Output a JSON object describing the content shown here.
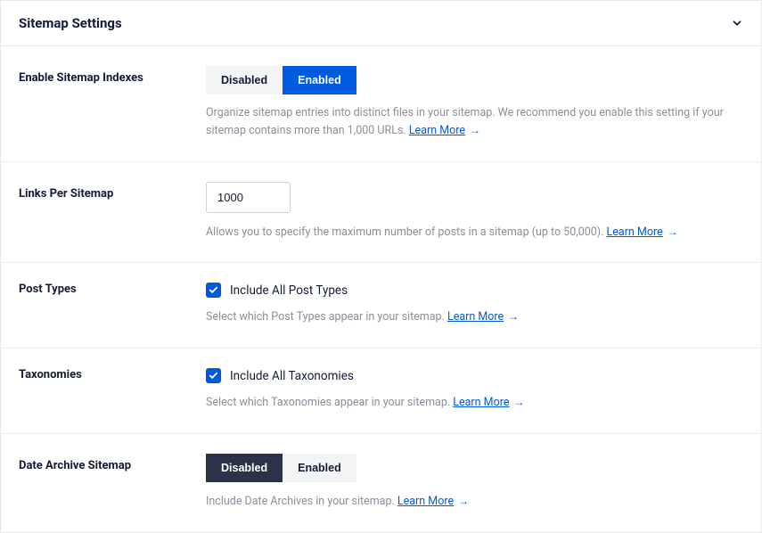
{
  "header": {
    "title": "Sitemap Settings"
  },
  "sitemap_indexes": {
    "label": "Enable Sitemap Indexes",
    "disabled": "Disabled",
    "enabled": "Enabled",
    "desc_prefix": "Organize sitemap entries into distinct files in your sitemap. We recommend you enable this setting if your sitemap contains more than 1,000 URLs. ",
    "learn_more": "Learn More"
  },
  "links_per_sitemap": {
    "label": "Links Per Sitemap",
    "value": "1000",
    "desc_prefix": "Allows you to specify the maximum number of posts in a sitemap (up to 50,000). ",
    "learn_more": "Learn More"
  },
  "post_types": {
    "label": "Post Types",
    "checkbox_label": "Include All Post Types",
    "desc_prefix": "Select which Post Types appear in your sitemap. ",
    "learn_more": "Learn More"
  },
  "taxonomies": {
    "label": "Taxonomies",
    "checkbox_label": "Include All Taxonomies",
    "desc_prefix": "Select which Taxonomies appear in your sitemap. ",
    "learn_more": "Learn More"
  },
  "date_archive": {
    "label": "Date Archive Sitemap",
    "disabled": "Disabled",
    "enabled": "Enabled",
    "desc_prefix": "Include Date Archives in your sitemap. ",
    "learn_more": "Learn More"
  }
}
